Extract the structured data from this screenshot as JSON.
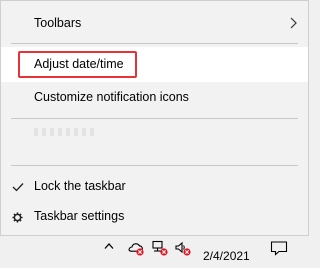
{
  "context_menu": {
    "items": [
      {
        "label": "Toolbars",
        "has_submenu": true
      },
      {
        "label": "Adjust date/time"
      },
      {
        "label": "Customize notification icons"
      },
      {
        "label": "Lock the taskbar",
        "checked": true
      },
      {
        "label": "Taskbar settings",
        "icon": "gear-icon"
      }
    ],
    "highlight_color": "#e8323a"
  },
  "taskbar": {
    "date": "2/4/2021",
    "tray_icons": [
      "chevron-up-icon",
      "onedrive-error-icon",
      "network-error-icon",
      "volume-error-icon",
      "action-center-icon"
    ]
  }
}
